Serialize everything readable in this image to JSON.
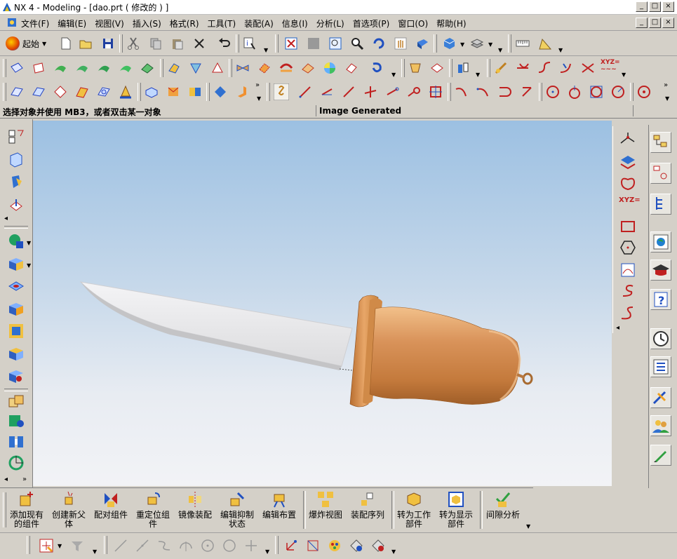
{
  "window": {
    "title": "NX 4 - Modeling - [dao.prt ( 修改的 ) ]",
    "buttons": [
      "_",
      "□",
      "×"
    ]
  },
  "menubar": {
    "items": [
      "文件(F)",
      "编辑(E)",
      "视图(V)",
      "插入(S)",
      "格式(R)",
      "工具(T)",
      "装配(A)",
      "信息(I)",
      "分析(L)",
      "首选项(P)",
      "窗口(O)",
      "帮助(H)"
    ]
  },
  "toolbar1": {
    "start_label": "起始"
  },
  "status": {
    "prompt": "选择对象并使用 MB3，或者双击某一对象",
    "message": "Image Generated"
  },
  "righttb_label": "XYZ=",
  "assembly_toolbar": {
    "items": [
      {
        "label": "添加现有\n的组件"
      },
      {
        "label": "创建新父\n体"
      },
      {
        "label": "配对组件"
      },
      {
        "label": "重定位组\n件"
      },
      {
        "label": "镜像装配"
      },
      {
        "label": "编辑抑制\n状态"
      },
      {
        "label": "编辑布置"
      },
      {
        "label": "爆炸视图"
      },
      {
        "label": "装配序列"
      },
      {
        "label": "转为工作\n部件"
      },
      {
        "label": "转为显示\n部件"
      },
      {
        "label": "间隙分析"
      }
    ]
  },
  "colors": {
    "handle": "#c8864a",
    "blade": "#e2e2e4",
    "viewport_top": "#9cc0e2",
    "viewport_bottom": "#f2f3f6"
  }
}
